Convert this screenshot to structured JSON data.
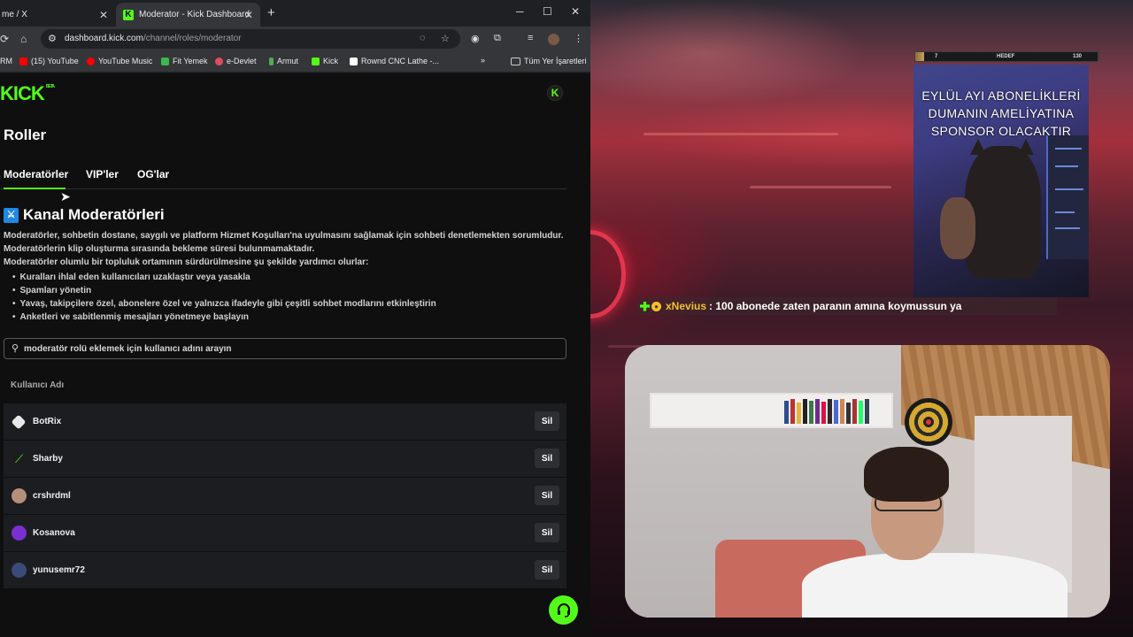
{
  "browser": {
    "tabs": [
      {
        "title": "me / X"
      },
      {
        "title": "Moderator - Kick Dashboard"
      }
    ],
    "url_host": "dashboard.kick.com",
    "url_path": "/channel/roles/moderator",
    "bookmarks": [
      {
        "label": "RM",
        "color": "#8a8a8a"
      },
      {
        "label": "(15) YouTube",
        "color": "#ff0000"
      },
      {
        "label": "YouTube Music",
        "color": "#ff0000"
      },
      {
        "label": "Fit Yemek",
        "color": "#3db84a"
      },
      {
        "label": "e-Devlet",
        "color": "#e14d5e"
      },
      {
        "label": "Armut",
        "color": "#4caf50"
      },
      {
        "label": "Kick",
        "color": "#53fc18"
      },
      {
        "label": "Rownd CNC Lathe -...",
        "color": "#ffffff"
      },
      {
        "label": "Tüm Yer İşaretleri",
        "color": "transparent"
      }
    ]
  },
  "page": {
    "logo": "KICK",
    "logo_badge": "BETA",
    "title": "Roller",
    "role_tabs": [
      "Moderatörler",
      "VIP'ler",
      "OG'lar"
    ],
    "active_tab": "Moderatörler",
    "section_title": "Kanal Moderatörleri",
    "description": [
      "Moderatörler, sohbetin dostane, saygılı ve platform Hizmet Koşulları'na uyulmasını sağlamak için sohbeti denetlemekten sorumludur.",
      "Moderatörlerin klip oluşturma sırasında bekleme süresi bulunmamaktadır.",
      "Moderatörler olumlu bir topluluk ortamının sürdürülmesine şu şekilde yardımcı olurlar:"
    ],
    "bullets": [
      "Kuralları ihlal eden kullanıcıları uzaklaştır veya yasakla",
      "Spamları yönetin",
      "Yavaş, takipçilere özel, abonelere özel ve yalnızca ifadeyle gibi çeşitli sohbet modlarını etkinleştirin",
      "Anketleri ve sabitlenmiş mesajları yönetmeye başlayın"
    ],
    "search_placeholder": "moderatör rolü eklemek için kullanıcı adını arayın",
    "table_header": "Kullanıcı Adı",
    "remove_label": "Sil",
    "moderators": [
      {
        "name": "BotRix",
        "icon": "diamond-icon",
        "color": "#2a2a2a"
      },
      {
        "name": "Sharby",
        "icon": "sword-icon",
        "color": "#1c1d20"
      },
      {
        "name": "crshrdml",
        "icon": "user-avatar",
        "color": "#b58f7a"
      },
      {
        "name": "Kosanova",
        "icon": "user-avatar",
        "color": "#7b2fd1"
      },
      {
        "name": "yunusemr72",
        "icon": "user-avatar",
        "color": "#3b4a7a"
      }
    ]
  },
  "stream": {
    "goal_left": "7",
    "goal_label": "HEDEF",
    "goal_right": "130",
    "goal_progress": 0.05,
    "sub_banner": [
      "EYLÜL AYI ABONELİKLERİ",
      "DUMANIN AMELİYATINA",
      "SPONSOR OLACAKTIR"
    ],
    "chat_user": "xNevius",
    "chat_text": ": 100 abonede zaten paranın amına koymussun ya"
  }
}
